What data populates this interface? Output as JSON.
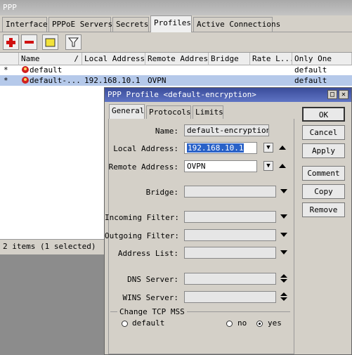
{
  "window": {
    "title": "PPP"
  },
  "tabs": [
    "Interface",
    "PPPoE Servers",
    "Secrets",
    "Profiles",
    "Active Connections"
  ],
  "toolbar": {
    "add": "+",
    "remove": "−"
  },
  "table": {
    "columns": [
      "Name",
      "Local Address",
      "Remote Address",
      "Bridge",
      "Rate L...",
      "Only One"
    ],
    "sort_marker": "/",
    "rows": [
      {
        "flag": "*",
        "name": "default",
        "local": "",
        "remote": "",
        "bridge": "",
        "rate": "",
        "only_one": "default"
      },
      {
        "flag": "*",
        "name": "default-...",
        "local": "192.168.10.1",
        "remote": "OVPN",
        "bridge": "",
        "rate": "",
        "only_one": "default"
      }
    ]
  },
  "status": "2 items (1 selected)",
  "dialog": {
    "title": "PPP Profile <default-encryption>",
    "tabs": [
      "General",
      "Protocols",
      "Limits"
    ],
    "fields": {
      "name_label": "Name:",
      "name_value": "default-encryption",
      "local_label": "Local Address:",
      "local_value": "192.168.10.1",
      "remote_label": "Remote Address:",
      "remote_value": "OVPN",
      "bridge_label": "Bridge:",
      "incoming_label": "Incoming Filter:",
      "outgoing_label": "Outgoing Filter:",
      "address_list_label": "Address List:",
      "dns_label": "DNS Server:",
      "wins_label": "WINS Server:"
    },
    "tcp_mss": {
      "legend": "Change TCP MSS",
      "options": [
        "default",
        "no",
        "yes"
      ],
      "selected": "yes"
    },
    "buttons": [
      "OK",
      "Cancel",
      "Apply",
      "Comment",
      "Copy",
      "Remove"
    ]
  }
}
